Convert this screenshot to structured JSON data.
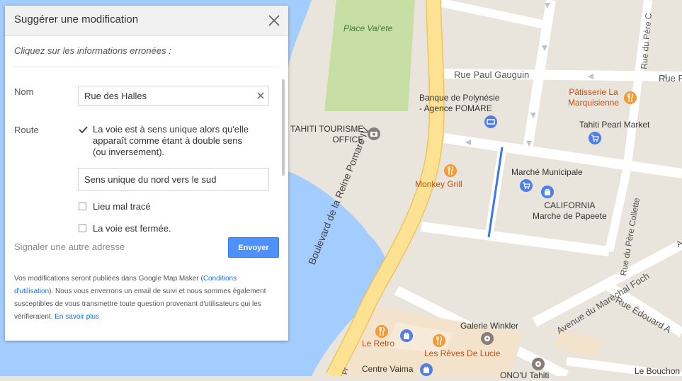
{
  "panel": {
    "title": "Suggérer une modification",
    "instruction": "Cliquez sur les informations erronées :",
    "name_label": "Nom",
    "name_value": "Rue des Halles",
    "route_label": "Route",
    "oneway_checked": true,
    "oneway_text_1": "La voie est à sens unique alors qu'elle",
    "oneway_text_2": "apparaît comme étant à double sens",
    "oneway_text_3": "(ou inversement).",
    "direction_value": "Sens unique du nord vers le sud",
    "misplaced_checked": false,
    "misplaced_text": "Lieu mal tracé",
    "closed_checked": false,
    "closed_text": "La voie est fermée.",
    "other_address": "Signaler une autre adresse",
    "send_label": "Envoyer",
    "footnote_1": "Vos modifications seront publiées dans Google Map Maker (",
    "footnote_link_1": "Conditions d'utilisation",
    "footnote_2": "). Nous vous enverrons un email de suivi et nous sommes également susceptibles de vous transmettre toute question provenant d'utilisateurs qui les vérifieraient. ",
    "footnote_link_2": "En savoir plus"
  },
  "map": {
    "park": "Place Vai'ete",
    "street_gauguin": "Rue Paul Gauguin",
    "street_gauguin_2": "Rue P",
    "street_boulevard": "Boulevard de la Reine Pomare IV",
    "street_pere_1": "Rue du Père C",
    "street_pere_2": "Rue du Père Collette",
    "street_foch": "Avenue du Maréchal Foch",
    "street_edouard": "Rue Édouard A",
    "street_a": "A",
    "street_pr": "Pr",
    "poi_bank_1": "Banque de Polynésie",
    "poi_bank_2": "- Agence POMARE",
    "poi_patisserie_1": "Pâtisserie La",
    "poi_patisserie_2": "Marquisienne",
    "poi_tourism_1": "TAHITI TOURISME",
    "poi_tourism_2": "OFFICE",
    "poi_pearl": "Tahiti Pearl Market",
    "poi_monkey": "Monkey Grill",
    "poi_marche": "Marché Municipale",
    "poi_california_1": "CALIFORNIA",
    "poi_california_2": "Marche de Papeete",
    "poi_winkler": "Galerie Winkler",
    "poi_retro": "Le Retro",
    "poi_reves": "Les Rêves De Lucie",
    "poi_vaima": "Centre Vaima",
    "poi_onou": "ONO'U Tahiti",
    "poi_bouchon": "Le Bouchon"
  },
  "colors": {
    "water": "#a3ccff",
    "land": "#e9e5dc",
    "park": "#c7dfa5",
    "road": "#ffffff",
    "boulevard": "#fde293",
    "boulevard_edge": "#f0c35c",
    "highlight": "#3b78e7",
    "food_pin": "#f29a33",
    "shop_pin": "#4e7fe6",
    "poi_pin": "#8a7d78",
    "send_button": "#4d90fe"
  },
  "icons": [
    "close-icon",
    "clear-icon",
    "checkbox-icon",
    "restaurant-icon",
    "shopping-icon",
    "camera-icon",
    "atm-icon",
    "museum-icon"
  ]
}
